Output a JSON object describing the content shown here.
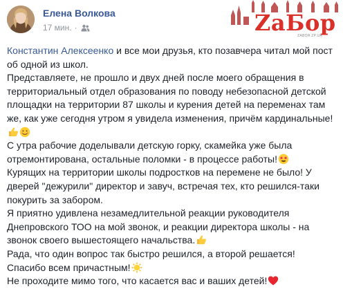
{
  "post": {
    "author": "Елена Волкова",
    "time": "17 мин.",
    "separator": "·",
    "privacy_icon": "friends-icon",
    "logo": {
      "text": "ZaБор",
      "subtext": "ZABOR.ZP.UA"
    },
    "paragraphs": [
      {
        "mention": "Константин Алексеенко",
        "text": " и все мои друзья, кто позавчера читал мой пост об одной из школ."
      },
      {
        "text": "Представляете, не прошло и двух дней после моего обращения в территориальный отдел образования по поводу небезопасной детской площадки на территории 87 школы и курения детей на переменах там же, как уже сегодня утром я увидела изменения, причём кардинальные!",
        "emojis": [
          "thumbs-up-emoji",
          "smiling-face-emoji"
        ]
      },
      {
        "text": "С утра рабочие доделывали детскую горку, скамейка уже была отремонтирована, остальные поломки - в процессе работы!",
        "emojis": [
          "star-struck-emoji"
        ]
      },
      {
        "text": "Курящих на территории школы подростков на перемене не было! У дверей \"дежурили\" директор и завуч, встречая тех, кто решился-таки покурить за забором."
      },
      {
        "text": "Я приятно удивлена незамедлительной реакции руководителя Днепровского ТОО на мой звонок, и реакции директора школы - на звонок своего вышестоящего начальства.",
        "emojis": [
          "thumbs-up-emoji"
        ]
      },
      {
        "text": "Рада, что один вопрос так быстро решился, а второй решается!"
      },
      {
        "text": "Спасибо всем причастным!",
        "emojis": [
          "sun-emoji"
        ]
      },
      {
        "text": "Не проходите мимо того, что касается вас и ваших детей!",
        "emojis": [
          "red-heart-emoji"
        ]
      }
    ]
  },
  "colors": {
    "link": "#385898",
    "meta": "#90949c",
    "body_text": "#1d2129",
    "logo_red": "#d9302a"
  }
}
